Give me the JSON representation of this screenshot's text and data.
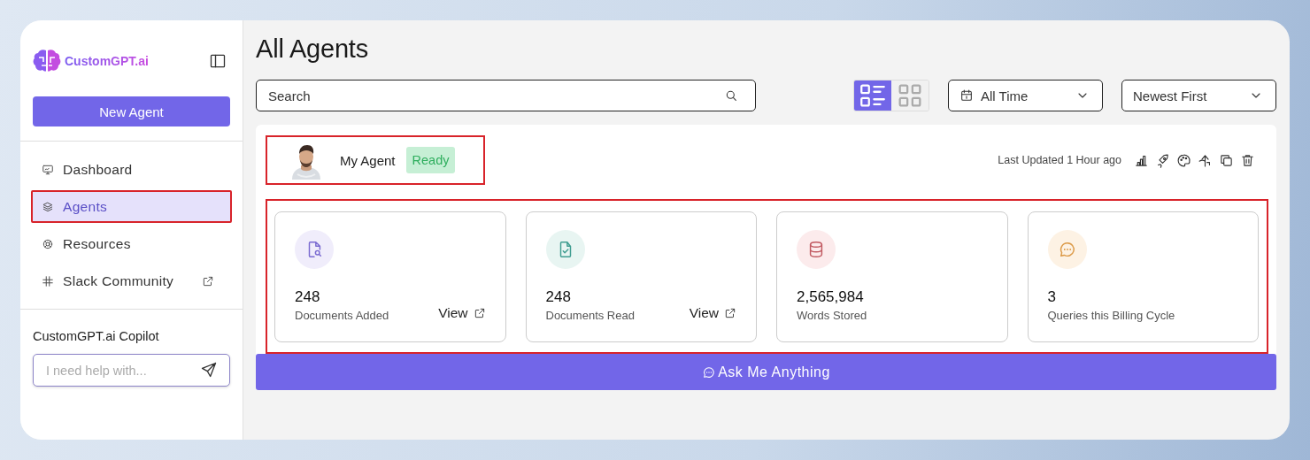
{
  "sidebar": {
    "logo": "CustomGPT.ai",
    "new_button": "New Agent",
    "nav": [
      {
        "kind": "monitor",
        "label": "Dashboard",
        "selected": false,
        "highlighted": false,
        "external": false
      },
      {
        "kind": "layers",
        "label": "Agents",
        "selected": true,
        "highlighted": true,
        "external": false
      },
      {
        "kind": "lifebuoy",
        "label": "Resources",
        "selected": false,
        "highlighted": false,
        "external": false
      },
      {
        "kind": "slack",
        "label": "Slack Community",
        "selected": false,
        "highlighted": false,
        "external": true
      }
    ],
    "copilot": {
      "title": "CustomGPT.ai Copilot",
      "placeholder": "I need help with..."
    }
  },
  "main": {
    "title": "All Agents",
    "search": {
      "placeholder": "Search"
    },
    "view_toggle": [
      {
        "kind": "list",
        "selected": true
      },
      {
        "kind": "grid",
        "selected": false
      }
    ],
    "time_filter": "All Time",
    "sort": "Newest First",
    "agent": {
      "name": "My Agent",
      "status": "Ready",
      "highlighted": true,
      "last_updated": "Last Updated 1 Hour ago",
      "actions": [
        {
          "kind": "chart"
        },
        {
          "kind": "rocket"
        },
        {
          "kind": "palette"
        },
        {
          "kind": "share"
        },
        {
          "kind": "copy"
        },
        {
          "kind": "trash"
        }
      ],
      "stats_highlighted": true,
      "stats": [
        {
          "kind": "docs-added",
          "value": "248",
          "label": "Documents Added",
          "link": "View"
        },
        {
          "kind": "docs-read",
          "value": "248",
          "label": "Documents Read",
          "link": "View"
        },
        {
          "kind": "words",
          "value": "2,565,984",
          "label": "Words Stored"
        },
        {
          "kind": "queries",
          "value": "3",
          "label": "Queries this Billing Cycle"
        }
      ],
      "ask_button": "Ask Me Anything"
    }
  }
}
